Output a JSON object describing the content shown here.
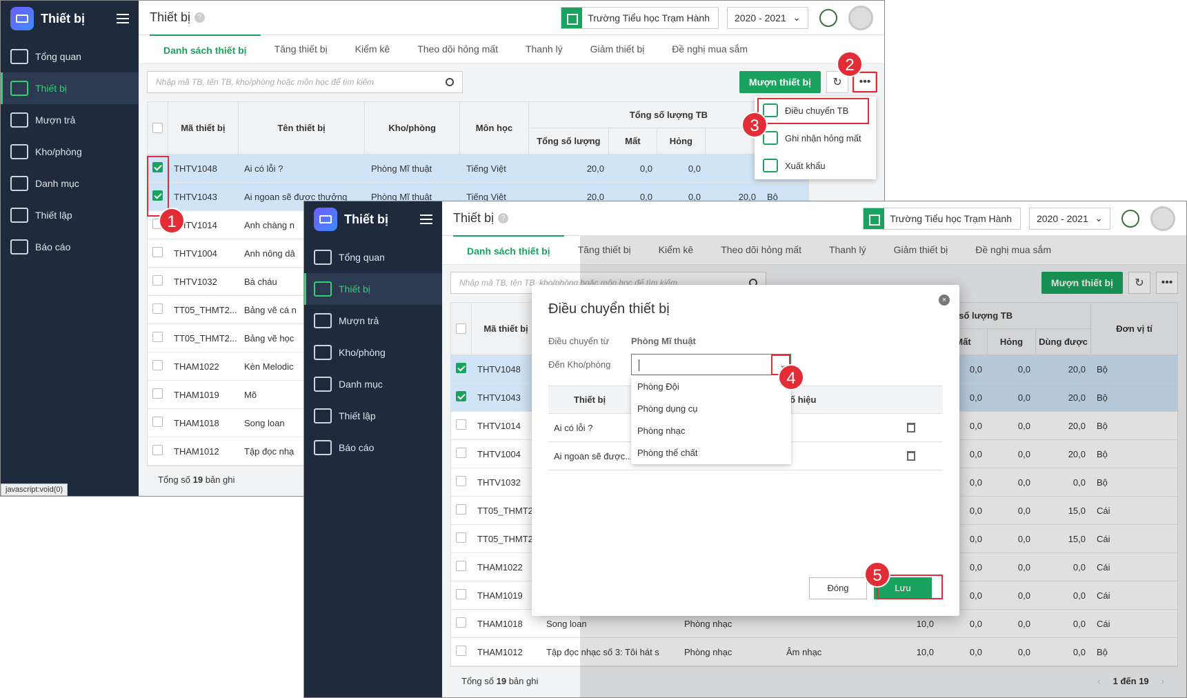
{
  "app": {
    "brand": "Thiết bị",
    "page_title": "Thiết bị",
    "help": "?",
    "school": "Trường Tiểu học Trạm Hành",
    "year": "2020 - 2021",
    "status_url": "javascript:void(0)"
  },
  "nav": [
    "Tổng quan",
    "Thiết bị",
    "Mượn trả",
    "Kho/phòng",
    "Danh mục",
    "Thiết lập",
    "Báo cáo"
  ],
  "tabs": [
    "Danh sách thiết bị",
    "Tăng thiết bị",
    "Kiểm kê",
    "Theo dõi hỏng mất",
    "Thanh lý",
    "Giảm thiết bị",
    "Đề nghị mua sắm"
  ],
  "search_placeholder": "Nhập mã TB, tên TB, kho/phòng hoặc môn học để tìm kiếm",
  "borrow_button": "Mượn thiết bị",
  "more_button": "•••",
  "refresh_button": "↻",
  "columns": {
    "code": "Mã thiết bị",
    "name": "Tên thiết bị",
    "room": "Kho/phòng",
    "subject": "Môn học",
    "total_group": "Tổng số lượng TB",
    "total": "Tổng số lượng",
    "lost": "Mất",
    "broken": "Hỏng",
    "usable": "Dùng được",
    "unit": "Đơn vị tí"
  },
  "rows1": [
    {
      "code": "THTV1048",
      "name": "Ai có lỗi ?",
      "room": "Phòng Mĩ thuật",
      "subject": "Tiếng Việt",
      "total": "20,0",
      "lost": "0,0",
      "broken": "0,0"
    },
    {
      "code": "THTV1043",
      "name": "Ai ngoan sẽ được thưởng",
      "room": "Phòng Mĩ thuật",
      "subject": "Tiếng Việt",
      "total": "20,0",
      "lost": "0,0",
      "broken": "0,0",
      "usable": "20,0",
      "unit": "Bộ"
    },
    {
      "code": "THTV1014",
      "name": "Anh chàng n"
    },
    {
      "code": "THTV1004",
      "name": "Anh nông dâ"
    },
    {
      "code": "THTV1032",
      "name": "Bà cháu"
    },
    {
      "code": "TT05_THMT2...",
      "name": "Bảng vẽ cá n"
    },
    {
      "code": "TT05_THMT2...",
      "name": "Bảng vẽ học"
    },
    {
      "code": "THAM1022",
      "name": "Kèn Melodic"
    },
    {
      "code": "THAM1019",
      "name": "Mõ"
    },
    {
      "code": "THAM1018",
      "name": "Song loan"
    },
    {
      "code": "THAM1012",
      "name": "Tập đọc nhạ"
    }
  ],
  "rows2": [
    {
      "code": "THTV1048",
      "lost": "0,0",
      "broken": "0,0",
      "usable": "20,0",
      "unit": "Bộ"
    },
    {
      "code": "THTV1043",
      "lost": "0,0",
      "broken": "0,0",
      "usable": "20,0",
      "unit": "Bộ"
    },
    {
      "code": "THTV1014",
      "lost": "0,0",
      "broken": "0,0",
      "usable": "20,0",
      "unit": "Bộ"
    },
    {
      "code": "THTV1004",
      "lost": "0,0",
      "broken": "0,0",
      "usable": "20,0",
      "unit": "Bộ"
    },
    {
      "code": "THTV1032",
      "lost": "0,0",
      "broken": "0,0",
      "usable": "0,0",
      "unit": "Bộ"
    },
    {
      "code": "TT05_THMT2",
      "lost": "0,0",
      "broken": "0,0",
      "usable": "15,0",
      "unit": "Cái"
    },
    {
      "code": "TT05_THMT2",
      "lost": "0,0",
      "broken": "0,0",
      "usable": "15,0",
      "unit": "Cái"
    },
    {
      "code": "THAM1022",
      "lost": "0,0",
      "broken": "0,0",
      "usable": "0,0",
      "unit": "Cái"
    },
    {
      "code": "THAM1019",
      "lost": "0,0",
      "broken": "0,0",
      "usable": "0,0",
      "unit": "Cái"
    },
    {
      "code": "THAM1018",
      "name": "Song loan",
      "room": "Phòng nhạc",
      "total": "10,0",
      "lost": "0,0",
      "broken": "0,0",
      "usable": "0,0",
      "unit": "Cái"
    },
    {
      "code": "THAM1012",
      "name": "Tập đọc nhạc số 3: Tôi hát s",
      "room": "Phòng nhạc",
      "subject": "Âm nhạc",
      "total": "10,0",
      "lost": "0,0",
      "broken": "0,0",
      "usable": "0,0",
      "unit": "Bộ"
    }
  ],
  "footer": {
    "prefix": "Tổng số",
    "count": "19",
    "suffix": "bản ghi",
    "pager": "1 đến 19",
    "prev": "‹",
    "next": "›"
  },
  "menu": [
    "Điều chuyển TB",
    "Ghi nhận hỏng mất",
    "Xuất khẩu"
  ],
  "dialog": {
    "title": "Điều chuyển thiết bị",
    "from_label": "Điều chuyển từ",
    "from_value": "Phòng Mĩ thuật",
    "to_label": "Đến Kho/phòng",
    "options": [
      "Phòng Đội",
      "Phòng dụng cụ",
      "Phòng nhạc",
      "Phòng thể chất"
    ],
    "col_device": "Thiết bị",
    "col_serial": "Số hiệu",
    "items": [
      "Ai có lỗi ?",
      "Ai ngoan sẽ được..."
    ],
    "cancel": "Đóng",
    "save": "Lưu",
    "close": "×",
    "dropdown": "⌄"
  },
  "markers": [
    "1",
    "2",
    "3",
    "4",
    "5"
  ],
  "accent": "#1aa35f",
  "marker_color": "#e32d36"
}
